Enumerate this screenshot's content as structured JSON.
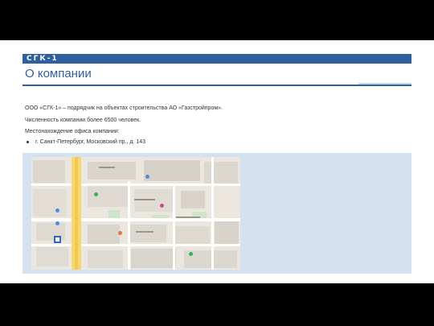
{
  "header": {
    "logo": "СГК-1",
    "title": "О компании"
  },
  "body": {
    "line1": "ООО «СГК-1» – подрядчик на объектах строительства АО «Газстройпром».",
    "line2": "Численность компании более 6500 человек.",
    "line3": "Местонахождение офиса компании:",
    "bullet1": "г. Санкт-Петербург, Московский пр., д. 143"
  },
  "colors": {
    "brand": "#2f5f9e",
    "panel": "#d3e1f0",
    "marker": "#2d67c4"
  },
  "icons": [
    "map-icon",
    "office-marker-icon"
  ]
}
